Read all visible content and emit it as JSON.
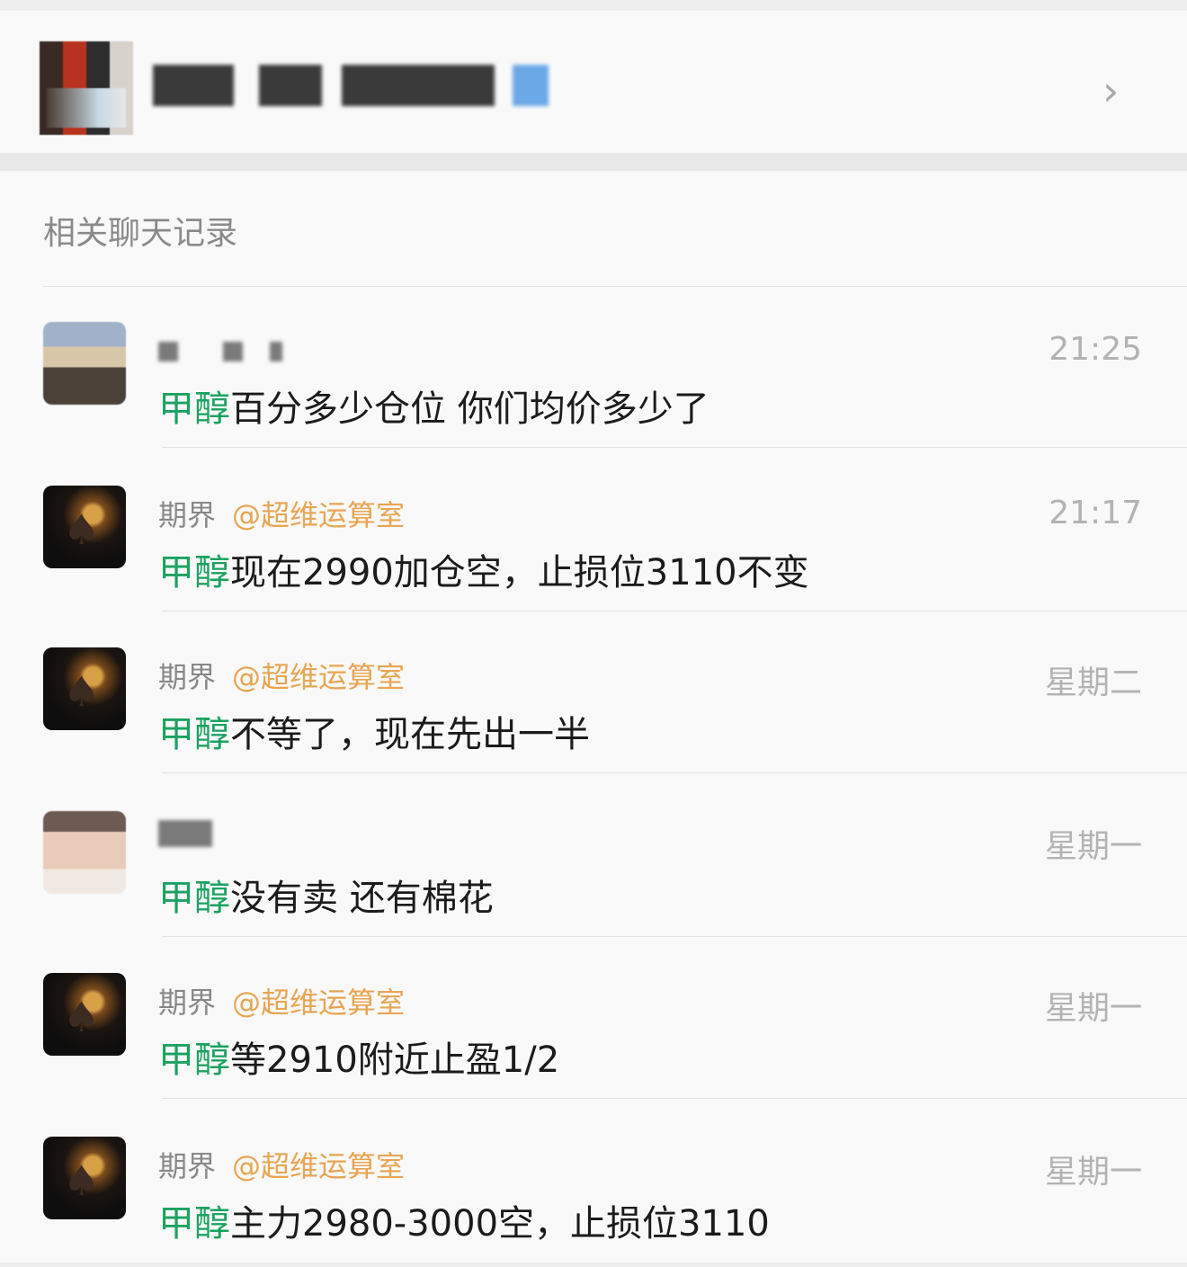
{
  "header": {
    "chevron_icon": "chevron-right-icon"
  },
  "section": {
    "title": "相关聊天记录"
  },
  "messages": [
    {
      "avatar": "sky",
      "sender": "",
      "mention": "",
      "keyword": "甲醇",
      "text": "百分多少仓位 你们均价多少了",
      "time": "21:25"
    },
    {
      "avatar": "dark",
      "sender": "期界",
      "mention": "@超维运算室",
      "keyword": "甲醇",
      "text": "现在2990加仓空，止损位3110不变",
      "time": "21:17"
    },
    {
      "avatar": "dark",
      "sender": "期界",
      "mention": "@超维运算室",
      "keyword": "甲醇",
      "text": "不等了，现在先出一半",
      "time": "星期二"
    },
    {
      "avatar": "child",
      "sender": "",
      "mention": "",
      "keyword": "甲醇",
      "text": "没有卖 还有棉花",
      "time": "星期一"
    },
    {
      "avatar": "dark",
      "sender": "期界",
      "mention": "@超维运算室",
      "keyword": "甲醇",
      "text": "等2910附近止盈1/2",
      "time": "星期一"
    },
    {
      "avatar": "dark",
      "sender": "期界",
      "mention": "@超维运算室",
      "keyword": "甲醇",
      "text": "主力2980-3000空，止损位3110",
      "time": "星期一"
    }
  ]
}
